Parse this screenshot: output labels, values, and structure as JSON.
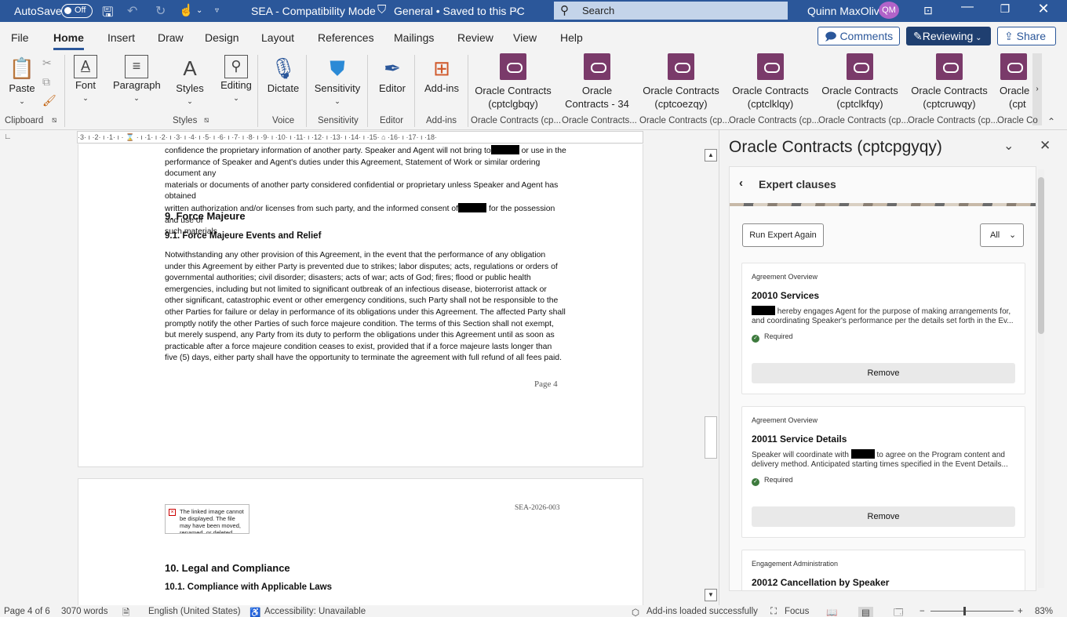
{
  "titlebar": {
    "autosave_label": "AutoSave",
    "autosave_state": "Off",
    "doc_title": "SEA  -  Compatibility Mode",
    "sensitivity": "General • Saved to this PC",
    "search_placeholder": "Search",
    "user_name": "Quinn MaxOliv",
    "user_initials": "QM"
  },
  "menu": {
    "tabs": [
      "File",
      "Home",
      "Insert",
      "Draw",
      "Design",
      "Layout",
      "References",
      "Mailings",
      "Review",
      "View",
      "Help"
    ],
    "active_tab": "Home",
    "comments_label": "Comments",
    "reviewing_label": "Reviewing",
    "share_label": "Share"
  },
  "ribbon": {
    "paste": "Paste",
    "font": "Font",
    "paragraph": "Paragraph",
    "styles": "Styles",
    "editing": "Editing",
    "dictate": "Dictate",
    "sensitivity": "Sensitivity",
    "editor": "Editor",
    "addins": "Add-ins",
    "oracle_buttons": [
      {
        "line1": "Oracle Contracts",
        "line2": "(cptclgbqy)"
      },
      {
        "line1": "Oracle",
        "line2": "Contracts - 34"
      },
      {
        "line1": "Oracle Contracts",
        "line2": "(cptcoezqy)"
      },
      {
        "line1": "Oracle Contracts",
        "line2": "(cptclklqy)"
      },
      {
        "line1": "Oracle Contracts",
        "line2": "(cptclkfqy)"
      },
      {
        "line1": "Oracle Contracts",
        "line2": "(cptcruwqy)"
      },
      {
        "line1": "Oracle",
        "line2": "(cpt"
      }
    ],
    "groups": {
      "clipboard": "Clipboard",
      "styles": "Styles",
      "voice": "Voice",
      "sensitivity": "Sensitivity",
      "editor": "Editor",
      "addins": "Add-ins",
      "oracle": [
        "Oracle Contracts (cp...",
        "Oracle Contracts...",
        "Oracle Contracts (cp...",
        "Oracle Contracts (cp...",
        "Oracle Contracts (cp...",
        "Oracle Contracts (cp...",
        "Oracle Co"
      ]
    }
  },
  "ruler": {
    "text": "·3· ı ·2· ı ·1· ı · ⌛ · ı ·1· ı ·2· ı ·3· ı ·4· ı ·5· ı ·6· ı ·7· ı ·8· ı ·9· ı ·10· ı ·11· ı ·12· ı ·13· ı ·14· ı ·15· ⌂ ·16· ı ·17· ı ·18·"
  },
  "document": {
    "top_para_l1a": "confidence the proprietary information of another party. Speaker and Agent will not bring to",
    "top_para_l1b": "or use in the",
    "top_para_l2": "performance of Speaker and Agent's duties under this Agreement, Statement of Work or similar ordering document any",
    "top_para_l3": "materials or documents of another party considered confidential or proprietary unless Speaker and Agent has obtained",
    "top_para_l4a": "written authorization and/or licenses from such party, and the informed consent of",
    "top_para_l4b": "for the possession and use of",
    "top_para_l5": "such materials",
    "h9": "9.    Force Majeure",
    "h91": "9.1.    Force Majeure Events and Relief",
    "fm_para": "Notwithstanding any other provision of this Agreement, in the event that the performance of any obligation under this Agreement by either Party is prevented due to strikes; labor disputes; acts, regulations or orders of governmental authorities; civil disorder; disasters; acts of war; acts of God; fires; flood or public health emergencies, including but not limited to significant outbreak of an infectious disease, bioterrorist attack or other significant, catastrophic event or other emergency conditions, such Party shall not be responsible to the other Parties for failure or delay in performance of its obligations under this Agreement. The affected Party shall promptly notify the other Parties of such force majeure condition. The terms of this Section shall not exempt, but merely suspend, any Party from its duty to perform the obligations under this Agreement until as soon as practicable after a force majeure condition ceases to exist, provided that if a force majeure lasts longer than five (5) days, either party shall have the opportunity to terminate the agreement with full refund of all fees paid.",
    "page_label": "Page 4",
    "doc_code": "SEA-2026-003",
    "broken_image_text": "The linked image cannot be displayed.  The file may have been moved, renamed, or deleted.",
    "h10": "10.  Legal and Compliance",
    "h101": "10.1.   Compliance with Applicable Laws"
  },
  "pane": {
    "title": "Oracle Contracts (cptcpgyqy)",
    "section": "Expert clauses",
    "run_label": "Run Expert Again",
    "filter_value": "All",
    "cards": [
      {
        "category": "Agreement Overview",
        "title": "20010 Services",
        "desc_a": "",
        "desc_b": " hereby engages Agent for the purpose of making arrangements for,",
        "desc_c": "and coordinating Speaker's performance per the details set forth in the Ev...",
        "status": "Required",
        "remove": "Remove"
      },
      {
        "category": "Agreement Overview",
        "title": "20011 Service Details",
        "desc_a": "Speaker will coordinate with ",
        "desc_b": " to agree on the Program content and",
        "desc_c": "delivery method. Anticipated starting times specified in the Event Details...",
        "status": "Required",
        "remove": "Remove"
      },
      {
        "category": "Engagement Administration",
        "title": "20012 Cancellation by Speaker"
      }
    ]
  },
  "status": {
    "page": "Page 4 of 6",
    "words": "3070 words",
    "language": "English (United States)",
    "accessibility": "Accessibility: Unavailable",
    "addins": "Add-ins loaded successfully",
    "focus": "Focus",
    "zoom": "83%"
  }
}
